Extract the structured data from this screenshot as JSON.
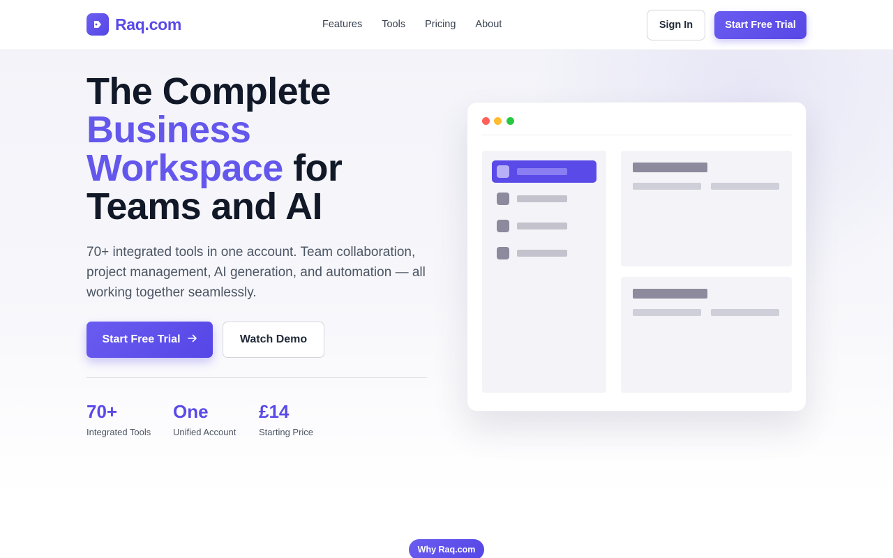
{
  "brand": {
    "name": "Raq.com",
    "logo_icon": "tag-icon",
    "accent_color": "#5a4ae8"
  },
  "nav": {
    "links": [
      "Features",
      "Tools",
      "Pricing",
      "About"
    ],
    "sign_in": "Sign In",
    "start_trial": "Start Free Trial"
  },
  "hero": {
    "headline_line1": "The Complete",
    "headline_accent_1": "Business",
    "headline_accent_2": "Workspace",
    "headline_for": "for",
    "headline_line4": "Teams and AI",
    "subtext": "70+ integrated tools in one account. Team collaboration, project management, AI generation, and automation — all working together seamlessly.",
    "primary_cta": "Start Free Trial",
    "primary_cta_icon": "arrow-right-icon",
    "secondary_cta": "Watch Demo"
  },
  "stats": [
    {
      "value": "70+",
      "label": "Integrated Tools"
    },
    {
      "value": "One",
      "label": "Unified Account"
    },
    {
      "value": "£14",
      "label": "Starting Price"
    }
  ],
  "mockup": {
    "window_dots": [
      "#ff5f57",
      "#febc2e",
      "#28c840"
    ]
  },
  "section_pill": "Why Raq.com"
}
